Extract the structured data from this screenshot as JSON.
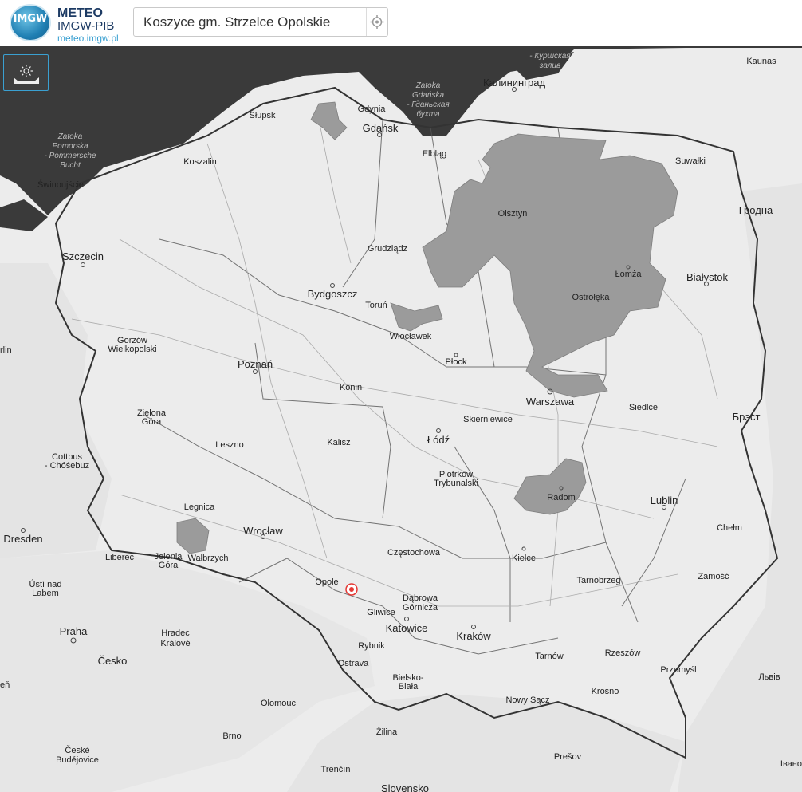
{
  "header": {
    "logo_text": "IMGW",
    "brand_line1": "METEO",
    "brand_line2": "IMGW-PIB",
    "brand_url": "meteo.imgw.pl"
  },
  "search": {
    "value": "Koszyce gm. Strzelce Opolskie"
  },
  "map": {
    "cities": {
      "gdynia": "Gdynia",
      "gdansk": "Gdańsk",
      "slupsk": "Słupsk",
      "koszalin": "Koszalin",
      "elblag": "Elbląg",
      "swinoujscie": "Świnoujście",
      "szczecin": "Szczecin",
      "olsztyn": "Olsztyn",
      "suwalki": "Suwałki",
      "grudziadz": "Grudziądz",
      "bydgoszcz": "Bydgoszcz",
      "torun": "Toruń",
      "lomza": "Łomża",
      "bialystok": "Białystok",
      "ostroleka": "Ostrołęka",
      "wloclawek": "Włocławek",
      "plock": "Płock",
      "gorzow1": "Gorzów",
      "gorzow2": "Wielkopolski",
      "poznan": "Poznań",
      "konin": "Konin",
      "warszawa": "Warszawa",
      "siedlce": "Siedlce",
      "zielona1": "Zielona",
      "zielona2": "Góra",
      "skierniewice": "Skierniewice",
      "leszno": "Leszno",
      "kalisz": "Kalisz",
      "lodz": "Łódź",
      "cottbus1": "Cottbus",
      "cottbus2": "- Chóśebuz",
      "piotrkow1": "Piotrków",
      "piotrkow2": "Trybunalski",
      "radom": "Radom",
      "lublin": "Lublin",
      "chelm": "Chełm",
      "legnica": "Legnica",
      "wroclaw": "Wrocław",
      "dresden": "Dresden",
      "czestochowa": "Częstochowa",
      "kielce": "Kielce",
      "liberec": "Liberec",
      "jelenia1": "Jelenia",
      "jelenia2": "Góra",
      "walbrzych": "Wałbrzych",
      "tarnobrzeg": "Tarnobrzeg",
      "zamosc": "Zamość",
      "opole": "Opole",
      "dabrowa1": "Dąbrowa",
      "dabrowa2": "Górnicza",
      "usti1": "Ústí nad",
      "usti2": "Labem",
      "gliwice": "Gliwice",
      "katowice": "Katowice",
      "praha": "Praha",
      "hradec1": "Hradec",
      "hradec2": "Králové",
      "rybnik": "Rybnik",
      "krakow": "Kraków",
      "tarnow": "Tarnów",
      "rzeszow": "Rzeszów",
      "cesko": "Česko",
      "ostrava": "Ostrava",
      "przemysl": "Przemyśl",
      "lviv": "Львів",
      "bielsko1": "Bielsko-",
      "bielsko2": "Biała",
      "krosno": "Krosno",
      "nowysacz": "Nowy Sącz",
      "olomouc": "Olomouc",
      "zilina": "Žilina",
      "brno": "Brno",
      "ceske1": "České",
      "ceske2": "Budějovice",
      "presov": "Prešov",
      "trencin": "Trenčín",
      "slovensko": "Slovensko",
      "ivano": "Івано",
      "kaliningrad": "Калининград",
      "kaunas": "Kaunas",
      "grodno": "Гродна",
      "brest": "Брэст",
      "berlin": "rlin",
      "cen": "eň"
    },
    "seas": {
      "gdansk_bay1": "Zatoka",
      "gdansk_bay2": "Gdańska",
      "gdansk_bay3": "- Гданьская",
      "gdansk_bay4": "бухта",
      "pomeranian1": "Zatoka",
      "pomeranian2": "Pomorska",
      "pomeranian3": "- Pommersche",
      "pomeranian4": "Bucht",
      "curonian1": "- Куршская",
      "curonian2": "залив"
    },
    "colors": {
      "sea": "#3a3a3a",
      "land": "#ececec",
      "warning_area": "#9b9b9b",
      "marker": "#e53935"
    }
  }
}
